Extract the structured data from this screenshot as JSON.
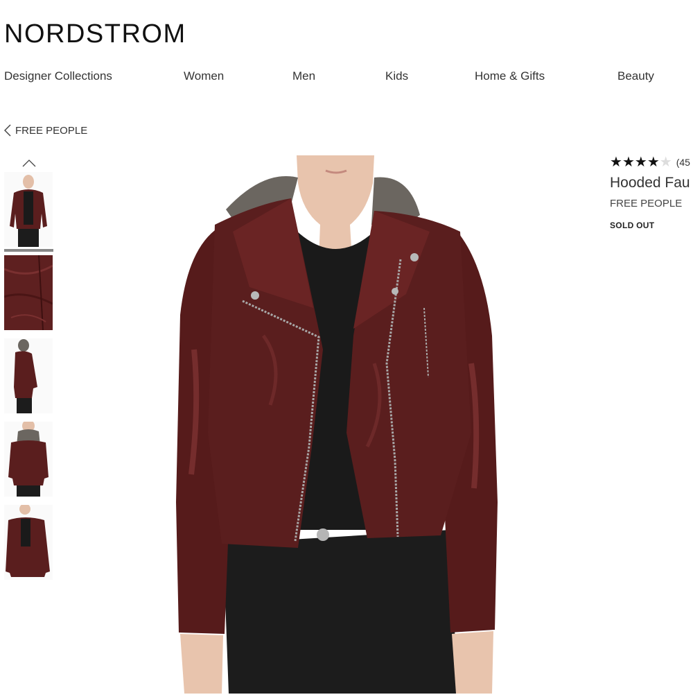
{
  "header": {
    "logo": "NORDSTROM",
    "nav": [
      {
        "label": "Designer Collections"
      },
      {
        "label": "Women"
      },
      {
        "label": "Men"
      },
      {
        "label": "Kids"
      },
      {
        "label": "Home & Gifts"
      },
      {
        "label": "Beauty"
      }
    ]
  },
  "breadcrumb": {
    "label": "FREE PEOPLE"
  },
  "gallery": {
    "thumbnails": [
      {
        "name": "front-view"
      },
      {
        "name": "leather-detail"
      },
      {
        "name": "side-view"
      },
      {
        "name": "hood-view"
      },
      {
        "name": "angle-view"
      }
    ],
    "selected_index": 0
  },
  "product": {
    "rating": 4,
    "rating_max": 5,
    "review_count": "(45",
    "title": "Hooded Fau",
    "brand": "FREE PEOPLE",
    "status": "SOLD OUT"
  },
  "colors": {
    "jacket": "#5a1e1e",
    "jacket_highlight": "#8a3a3a",
    "hood": "#6b6660",
    "shirt": "#1a1a1a",
    "jeans": "#1c1c1c",
    "skin": "#e8c4ad"
  }
}
